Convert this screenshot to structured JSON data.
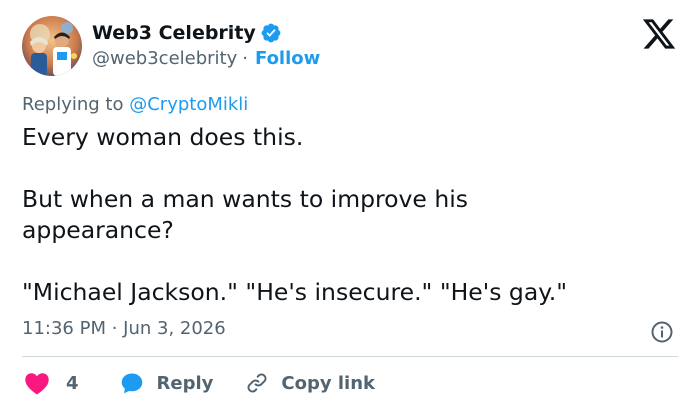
{
  "author": {
    "display_name": "Web3 Celebrity",
    "handle": "@web3celebrity",
    "separator": "·",
    "follow_label": "Follow",
    "verified_color": "#1d9bf0"
  },
  "reply_context": {
    "prefix": "Replying to",
    "mention": "@CryptoMikli"
  },
  "tweet": {
    "text": "Every woman does this.\n\nBut when a man wants to improve his\nappearance?\n\n\"Michael Jackson.\" \"He's insecure.\" \"He's gay.\"",
    "timestamp": "11:36 PM · Jun 3, 2026"
  },
  "actions": {
    "like_count": "4",
    "reply_label": "Reply",
    "copy_link_label": "Copy link"
  },
  "icons": {
    "x_logo": "x-logo-icon",
    "verified": "verified-badge-icon",
    "info": "info-icon",
    "like": "heart-icon",
    "reply": "speech-bubble-icon",
    "copy": "link-icon"
  },
  "colors": {
    "text_primary": "#0f1419",
    "text_secondary": "#536471",
    "accent": "#1d9bf0",
    "like": "#f91880",
    "divider": "#cfd9de"
  }
}
